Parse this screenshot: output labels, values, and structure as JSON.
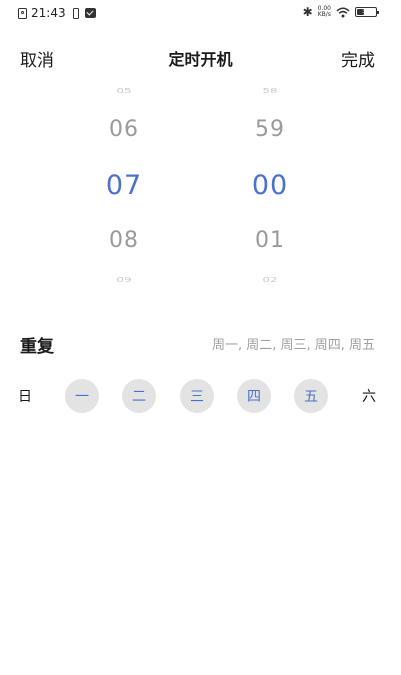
{
  "status_bar": {
    "time": "21:43",
    "net_speed_value": "0.00",
    "net_speed_unit": "KB/s",
    "battery_level": "37",
    "icons": [
      "file-icon",
      "phone-icon",
      "message-icon",
      "bluetooth-icon",
      "wifi-icon",
      "battery-icon"
    ]
  },
  "header": {
    "cancel_label": "取消",
    "title": "定时开机",
    "done_label": "完成"
  },
  "time_picker": {
    "hours": {
      "far_above": "05",
      "above": "06",
      "selected": "07",
      "below": "08",
      "far_below": "09"
    },
    "minutes": {
      "far_above": "58",
      "above": "59",
      "selected": "00",
      "below": "01",
      "far_below": "02"
    },
    "selected_color": "#4a72cc"
  },
  "repeat": {
    "label": "重复",
    "summary": "周一, 周二, 周三, 周四, 周五"
  },
  "days": [
    {
      "label": "日",
      "selected": false
    },
    {
      "label": "一",
      "selected": true
    },
    {
      "label": "二",
      "selected": true
    },
    {
      "label": "三",
      "selected": true
    },
    {
      "label": "四",
      "selected": true
    },
    {
      "label": "五",
      "selected": true
    },
    {
      "label": "六",
      "selected": false
    }
  ]
}
